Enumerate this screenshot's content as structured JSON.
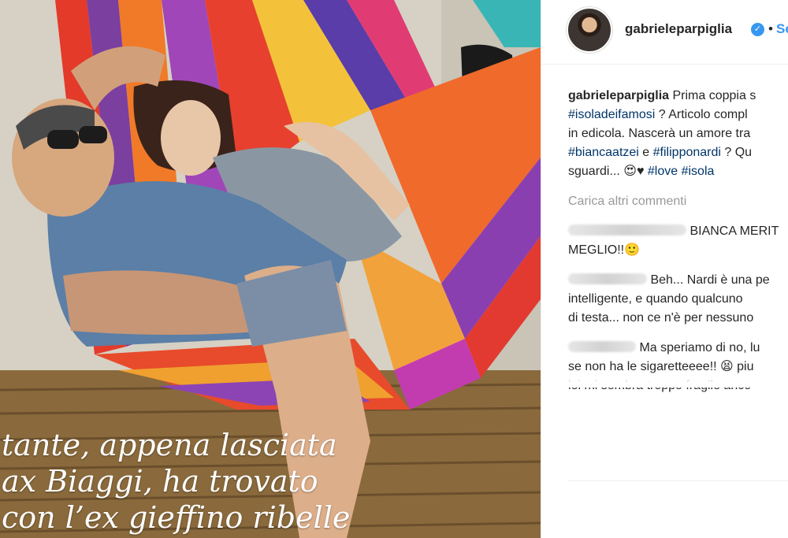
{
  "photo": {
    "caption_lines": [
      "tante, appena lasciata",
      "ax Biaggi, ha trovato",
      "con l’ex gieffino ribelle"
    ]
  },
  "post": {
    "username": "gabrieleparpiglia",
    "verified_icon": "check",
    "dot": "•",
    "follow_label": "Se"
  },
  "caption": {
    "author": "gabrieleparpiglia",
    "line1_text": "Prima coppia s",
    "line2_tag": "#isoladeifamosi",
    "line2_text": "? Articolo compl",
    "line3_text": "in edicola. Nascerà un amore tra",
    "line4_tag1": "#biancaatzei",
    "line4_mid": "e",
    "line4_tag2": "#filipponardi",
    "line4_text": "? Qu",
    "line5_text": "sguardi... 😍♥",
    "line5_tag1": "#love",
    "line5_tag2": "#isola"
  },
  "load_more": "Carica altri commenti",
  "comments": [
    {
      "lines": [
        "BIANCA MERIT",
        "MEGLIO!!🙂"
      ]
    },
    {
      "lines": [
        "Beh... Nardi è una pe",
        "intelligente, e quando qualcuno",
        "di testa... non ce n'è per nessuno"
      ]
    },
    {
      "lines": [
        "Ma speriamo di no, lu",
        "se non ha le sigaretteeee!! 😫 piu",
        "lei mi sembra troppo fragile anco"
      ]
    }
  ],
  "colors": {
    "link": "#003569",
    "follow": "#3897f0",
    "muted": "#999999"
  }
}
